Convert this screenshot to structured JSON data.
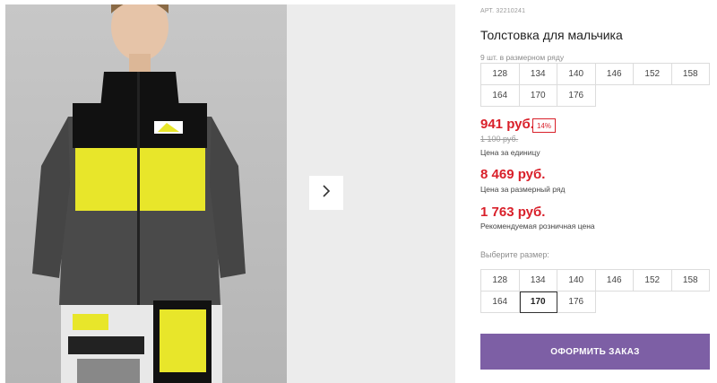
{
  "product": {
    "article": "АРТ. 32210241",
    "title": "Толстовка для мальчика",
    "row_note": "9 шт. в размерном ряду",
    "image_alt": "Мальчик в толстовке"
  },
  "sizes_row": [
    "128",
    "134",
    "140",
    "146",
    "152",
    "158",
    "164",
    "170",
    "176"
  ],
  "prices": {
    "unit_price": "941 руб.",
    "discount": "14%",
    "old_price": "1 100 руб.",
    "unit_note": "Цена за единицу",
    "row_price": "8 469 руб.",
    "row_note": "Цена за размерный ряд",
    "retail_price": "1 763 руб.",
    "retail_note": "Рекомендуемая розничная цена"
  },
  "size_picker": {
    "label": "Выберите размер:",
    "sizes": [
      "128",
      "134",
      "140",
      "146",
      "152",
      "158",
      "164",
      "170",
      "176"
    ],
    "selected": "170"
  },
  "actions": {
    "order_label": "ОФОРМИТЬ ЗАКАЗ"
  },
  "colors": {
    "accent": "#7d5fa5",
    "price": "#d9202a"
  },
  "icons": {
    "next": "chevron-right-icon"
  }
}
